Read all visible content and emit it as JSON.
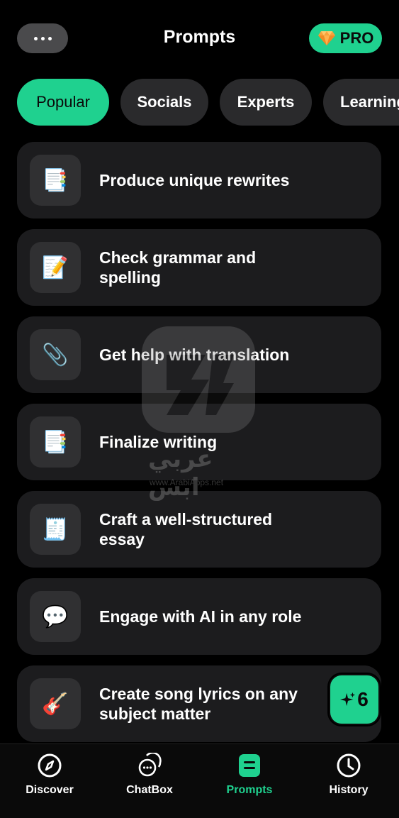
{
  "header": {
    "title": "Prompts",
    "pro_label": "PRO",
    "menu_icon": "ellipsis-icon",
    "pro_icon": "diamond-icon"
  },
  "tabs": [
    {
      "label": "Popular",
      "active": true
    },
    {
      "label": "Socials",
      "active": false
    },
    {
      "label": "Experts",
      "active": false
    },
    {
      "label": "Learning",
      "active": false
    }
  ],
  "prompts": [
    {
      "label": "Produce unique rewrites",
      "icon": "📑",
      "icon_name": "document-icon"
    },
    {
      "label": "Check grammar and spelling",
      "icon": "📝",
      "icon_name": "memo-icon"
    },
    {
      "label": "Get help with translation",
      "icon": "📎",
      "icon_name": "paperclip-icon"
    },
    {
      "label": "Finalize writing",
      "icon": "📑",
      "icon_name": "document-icon"
    },
    {
      "label": "Craft a well-structured essay",
      "icon": "🧾",
      "icon_name": "receipt-icon"
    },
    {
      "label": "Engage with AI in any role",
      "icon": "💬",
      "icon_name": "speech-bubble-icon"
    },
    {
      "label": "Create song lyrics on any subject matter",
      "icon": "🎸",
      "icon_name": "guitar-icon"
    }
  ],
  "credits": {
    "count": "6",
    "icon": "sparkle-icon"
  },
  "watermark": {
    "arabic": "عربي ابس",
    "url": "www.ArabiApps.net"
  },
  "bottom_nav": [
    {
      "label": "Discover",
      "icon": "compass-icon",
      "active": false
    },
    {
      "label": "ChatBox",
      "icon": "chat-bubbles-icon",
      "active": false
    },
    {
      "label": "Prompts",
      "icon": "prompts-icon",
      "active": true
    },
    {
      "label": "History",
      "icon": "clock-icon",
      "active": false
    }
  ],
  "colors": {
    "accent": "#1fd18f",
    "background": "#000000",
    "card": "#1c1c1e",
    "pill": "#2a2a2c"
  }
}
